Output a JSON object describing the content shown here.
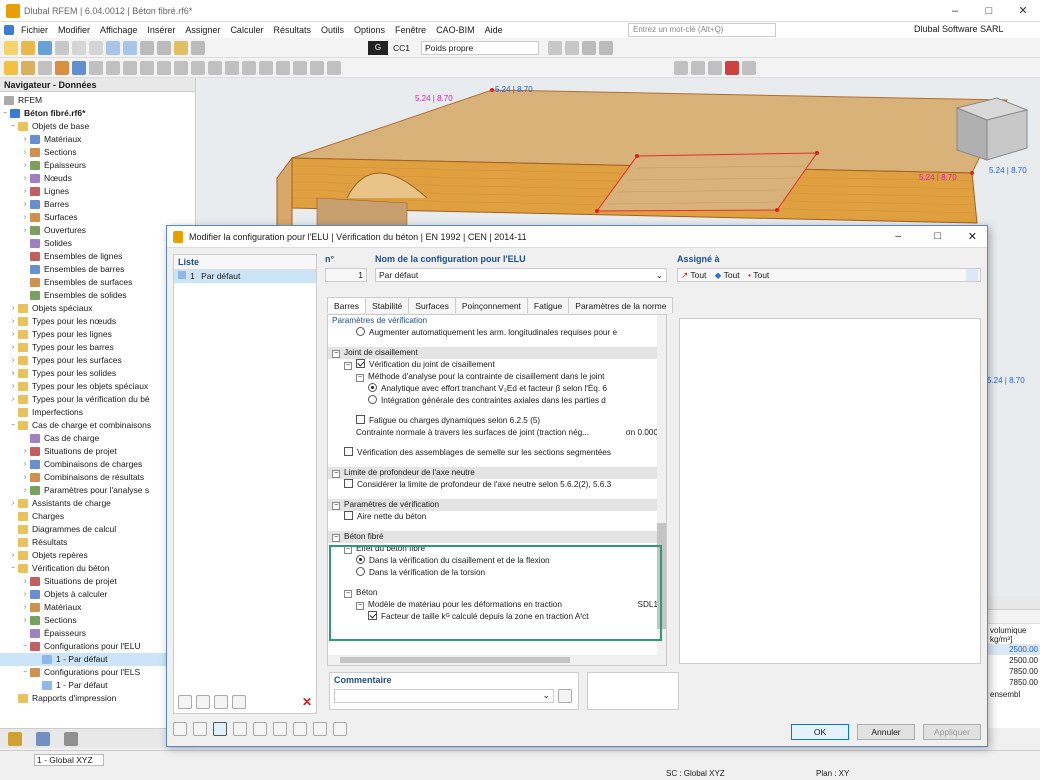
{
  "app": {
    "title": "Dlubal RFEM | 6.04.0012 | Béton fibré.rf6*",
    "search_placeholder": "Entrez un mot-clé (Alt+Q)",
    "company": "Dlubal Software SARL",
    "load_case_code": "CC1",
    "load_case_name": "Poids propre",
    "load_case_badge": "G"
  },
  "menu": [
    "Fichier",
    "Modifier",
    "Affichage",
    "Insérer",
    "Assigner",
    "Calculer",
    "Résultats",
    "Outils",
    "Options",
    "Fenêtre",
    "CAO-BIM",
    "Aide"
  ],
  "navigator": {
    "title": "Navigateur - Données",
    "root": "RFEM",
    "file": "Béton fibré.rf6*",
    "items": [
      {
        "label": "Objets de base",
        "level": 1,
        "exp": "-"
      },
      {
        "label": "Matériaux",
        "level": 2,
        "exp": ">"
      },
      {
        "label": "Sections",
        "level": 2,
        "exp": ">"
      },
      {
        "label": "Épaisseurs",
        "level": 2,
        "exp": ">"
      },
      {
        "label": "Nœuds",
        "level": 2,
        "exp": ">"
      },
      {
        "label": "Lignes",
        "level": 2,
        "exp": ">"
      },
      {
        "label": "Barres",
        "level": 2,
        "exp": ">"
      },
      {
        "label": "Surfaces",
        "level": 2,
        "exp": ">"
      },
      {
        "label": "Ouvertures",
        "level": 2,
        "exp": ">"
      },
      {
        "label": "Solides",
        "level": 2,
        "exp": ""
      },
      {
        "label": "Ensembles de lignes",
        "level": 2,
        "exp": ""
      },
      {
        "label": "Ensembles de barres",
        "level": 2,
        "exp": ""
      },
      {
        "label": "Ensembles de surfaces",
        "level": 2,
        "exp": ""
      },
      {
        "label": "Ensembles de solides",
        "level": 2,
        "exp": ""
      },
      {
        "label": "Objets spéciaux",
        "level": 1,
        "exp": ">"
      },
      {
        "label": "Types pour les nœuds",
        "level": 1,
        "exp": ">"
      },
      {
        "label": "Types pour les lignes",
        "level": 1,
        "exp": ">"
      },
      {
        "label": "Types pour les barres",
        "level": 1,
        "exp": ">"
      },
      {
        "label": "Types pour les surfaces",
        "level": 1,
        "exp": ">"
      },
      {
        "label": "Types pour les solides",
        "level": 1,
        "exp": ">"
      },
      {
        "label": "Types pour les objets spéciaux",
        "level": 1,
        "exp": ">"
      },
      {
        "label": "Types pour la vérification du bé",
        "level": 1,
        "exp": ">"
      },
      {
        "label": "Imperfections",
        "level": 1,
        "exp": ""
      },
      {
        "label": "Cas de charge et combinaisons",
        "level": 1,
        "exp": "-"
      },
      {
        "label": "Cas de charge",
        "level": 2,
        "exp": ""
      },
      {
        "label": "Situations de projet",
        "level": 2,
        "exp": ">"
      },
      {
        "label": "Combinaisons de charges",
        "level": 2,
        "exp": ">"
      },
      {
        "label": "Combinaisons de résultats",
        "level": 2,
        "exp": ">"
      },
      {
        "label": "Paramètres pour l'analyse s",
        "level": 2,
        "exp": ">"
      },
      {
        "label": "Assistants de charge",
        "level": 1,
        "exp": ">"
      },
      {
        "label": "Charges",
        "level": 1,
        "exp": ""
      },
      {
        "label": "Diagrammes de calcul",
        "level": 1,
        "exp": ""
      },
      {
        "label": "Résultats",
        "level": 1,
        "exp": ""
      },
      {
        "label": "Objets repères",
        "level": 1,
        "exp": ">"
      },
      {
        "label": "Vérification du béton",
        "level": 1,
        "exp": "-"
      },
      {
        "label": "Situations de projet",
        "level": 2,
        "exp": ">"
      },
      {
        "label": "Objets à calculer",
        "level": 2,
        "exp": ">"
      },
      {
        "label": "Matériaux",
        "level": 2,
        "exp": ">"
      },
      {
        "label": "Sections",
        "level": 2,
        "exp": ">"
      },
      {
        "label": "Épaisseurs",
        "level": 2,
        "exp": ""
      },
      {
        "label": "Configurations pour l'ELU",
        "level": 2,
        "exp": "-"
      },
      {
        "label": "1 - Par défaut",
        "level": 3,
        "exp": "",
        "sel": true
      },
      {
        "label": "Configurations pour l'ELS",
        "level": 2,
        "exp": "-"
      },
      {
        "label": "1 - Par défaut",
        "level": 3,
        "exp": ""
      },
      {
        "label": "Rapports d'impression",
        "level": 1,
        "exp": ""
      }
    ]
  },
  "viewport": {
    "labels": [
      "5.24 | 8.70",
      "5.24 | 8.70",
      "5.24 | 8.70",
      "5.24 | 8.70",
      "5.24 | 8.70"
    ],
    "right_panel": {
      "header": "volumique",
      "unit": "kg/m³]",
      "values": [
        "2500.00",
        "2500.00",
        "7850.00",
        "7850.00"
      ],
      "footer": "ensembl"
    }
  },
  "status": {
    "coord_system": "1 - Global XYZ",
    "sc": "SC : Global XYZ",
    "plan": "Plan : XY"
  },
  "dialog": {
    "title": "Modifier la configuration pour l'ELU | Vérification du béton | EN 1992 | CEN | 2014-11",
    "list_label": "Liste",
    "list_item_no": "1",
    "list_item_name": "Par défaut",
    "no_label": "n°",
    "no_value": "1",
    "name_label": "Nom de la configuration pour l'ELU",
    "name_value": "Par défaut",
    "assigned_label": "Assigné à",
    "assigned": [
      "Tout",
      "Tout",
      "Tout"
    ],
    "tabs": [
      "Barres",
      "Stabilité",
      "Surfaces",
      "Poinçonnement",
      "Fatigue",
      "Paramètres de la norme"
    ],
    "rows": [
      {
        "text": "Paramètres de vérification",
        "indent": 0,
        "kind": "headlabel"
      },
      {
        "text": "Augmenter automatiquement les arm. longitudinales requises pour e",
        "indent": 2,
        "kind": "radio"
      },
      {
        "text": "",
        "indent": 0,
        "kind": "blank"
      },
      {
        "text": "Joint de cisaillement",
        "indent": 0,
        "kind": "section"
      },
      {
        "text": "Vérification du joint de cisaillement",
        "indent": 1,
        "kind": "checkon",
        "minus": true
      },
      {
        "text": "Méthode d'analyse pour la contrainte de cisaillement dans le joint",
        "indent": 2,
        "kind": "plain",
        "minus": true
      },
      {
        "text": "Analytique avec effort tranchant V₂Ed et facteur β selon l'Éq. 6",
        "indent": 3,
        "kind": "radioon"
      },
      {
        "text": "Intégration générale des contraintes axiales dans les parties d",
        "indent": 3,
        "kind": "radio"
      },
      {
        "text": "",
        "indent": 0,
        "kind": "blank"
      },
      {
        "text": "Fatigue ou charges dynamiques selon 6.2.5 (5)",
        "indent": 2,
        "kind": "check"
      },
      {
        "text": "Contrainte normale à travers les surfaces de joint (traction nég...",
        "indent": 2,
        "kind": "plain",
        "val": "σn  0.000"
      },
      {
        "text": "",
        "indent": 0,
        "kind": "blank"
      },
      {
        "text": "Vérification des assemblages de semelle sur les sections segmentées",
        "indent": 1,
        "kind": "check"
      },
      {
        "text": "",
        "indent": 0,
        "kind": "blank"
      },
      {
        "text": "Limite de profondeur de l'axe neutre",
        "indent": 0,
        "kind": "section"
      },
      {
        "text": "Considérer la limite de profondeur de l'axe neutre selon 5.6.2(2), 5.6.3",
        "indent": 1,
        "kind": "check"
      },
      {
        "text": "",
        "indent": 0,
        "kind": "blank"
      },
      {
        "text": "Paramètres de vérification",
        "indent": 0,
        "kind": "section"
      },
      {
        "text": "Aire nette du béton",
        "indent": 1,
        "kind": "check"
      },
      {
        "text": "",
        "indent": 0,
        "kind": "blank"
      },
      {
        "text": "Béton fibré",
        "indent": 0,
        "kind": "section"
      },
      {
        "text": "Effet du béton fibré",
        "indent": 1,
        "kind": "plain",
        "minus": true
      },
      {
        "text": "Dans la vérification du cisaillement et de la flexion",
        "indent": 2,
        "kind": "radioon"
      },
      {
        "text": "Dans la vérification de la torsion",
        "indent": 2,
        "kind": "radio"
      },
      {
        "text": "",
        "indent": 0,
        "kind": "blank"
      },
      {
        "text": "Béton",
        "indent": 1,
        "kind": "plain",
        "minus": true
      },
      {
        "text": "Modèle de matériau pour les déformations en traction",
        "indent": 2,
        "kind": "plain",
        "minus": true,
        "val": "SDL1"
      },
      {
        "text": "Facteur de taille kᴳ calculé depuis la zone en traction Aᶠct",
        "indent": 3,
        "kind": "checkon"
      }
    ],
    "comment_label": "Commentaire",
    "buttons": {
      "ok": "OK",
      "cancel": "Annuler",
      "apply": "Appliquer"
    }
  }
}
